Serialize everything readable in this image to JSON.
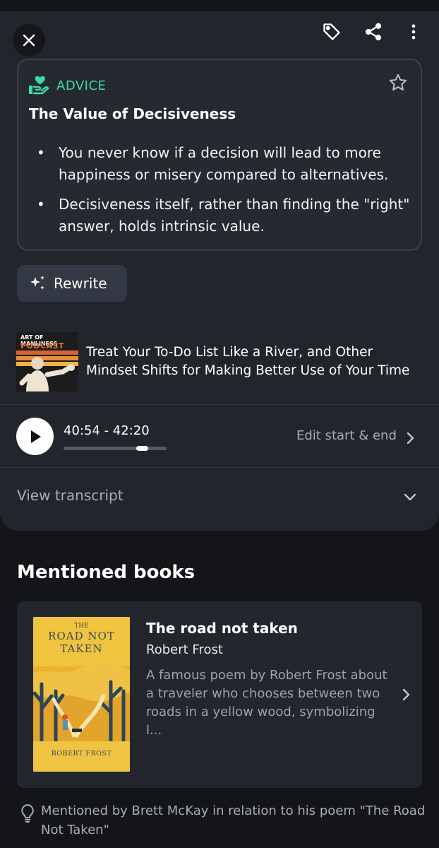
{
  "header": {
    "icons": [
      "close-icon",
      "tag-icon",
      "share-icon",
      "more-vertical-icon"
    ]
  },
  "insight": {
    "category": "ADVICE",
    "category_icon": "hand-heart-icon",
    "title": "The Value of Decisiveness",
    "bullets": [
      "You never know if a decision will lead to more happiness or misery compared to alternatives.",
      "Decisiveness itself, rather than finding the \"right\" answer, holds intrinsic value."
    ],
    "accent_color": "#3fd9a1"
  },
  "rewrite": {
    "label": "Rewrite"
  },
  "episode": {
    "podcast_art_line1": "ART OF MANLINESS",
    "podcast_art_line2": "PODCAST",
    "title": "Treat Your To-Do List Like a River, and Other Mindset Shifts for Making Better Use of Your Time"
  },
  "clip": {
    "time_range": "40:54 - 42:20",
    "edit_label": "Edit start & end"
  },
  "transcript": {
    "label": "View transcript"
  },
  "books_section": {
    "title": "Mentioned books",
    "book": {
      "title": "The road not taken",
      "author": "Robert Frost",
      "description": "A famous poem by Robert Frost about a traveler who chooses between two roads in a yellow wood, symbolizing l...",
      "cover_the": "THE",
      "cover_title_line1": "ROAD NOT",
      "cover_title_line2": "TAKEN",
      "cover_author": "ROBERT FROST"
    },
    "mention_note": "Mentioned by Brett McKay in relation to his poem \"The Road Not Taken\""
  }
}
